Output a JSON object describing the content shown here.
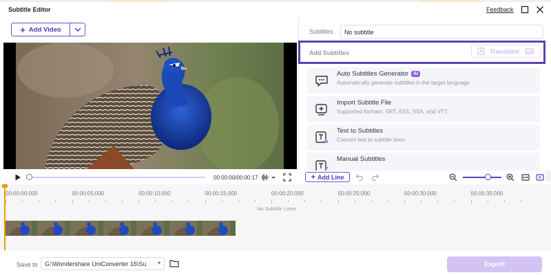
{
  "window": {
    "title": "Subtitle Editor",
    "feedback_label": "Feedback"
  },
  "toolbar": {
    "add_video_label": "Add Video"
  },
  "subtitles": {
    "label": "Subtitles",
    "selected_value": "No subtitle"
  },
  "add_subtitles": {
    "label": "Add Subtitles",
    "translator_label": "Translator",
    "translator_badge": "AI"
  },
  "options": [
    {
      "title": "Auto Subtitles Generator",
      "badge": "AI",
      "desc": "Automatically generate subtitles in the target language.",
      "icon": "speech-bubble-icon"
    },
    {
      "title": "Import Subtitle File",
      "desc": "Supported formats: SRT, ASS, SSA, and VTT.",
      "icon": "import-subtitle-icon"
    },
    {
      "title": "Text to Subtitles",
      "desc": "Convert text to subtitle lines.",
      "icon": "text-to-subtitle-icon"
    },
    {
      "title": "Manual Subtitles",
      "desc": "",
      "icon": "manual-subtitle-icon"
    }
  ],
  "player": {
    "timecode": "00:00:00/00:00:17",
    "add_line_label": "Add Line",
    "progress": 0
  },
  "timeline": {
    "ruler": [
      "00:00:00:000",
      "00:00:05:000",
      "00:00:10:000",
      "00:00:15:000",
      "00:00:20:000",
      "00:00:25:000",
      "00:00:30:000",
      "00:00:35:000"
    ],
    "empty_message": "No Subtitle Lines"
  },
  "footer": {
    "save_to_label": "Save to",
    "save_path": "G:\\Wondershare UniConverter 16\\Su",
    "export_label": "Export"
  },
  "colors": {
    "accent": "#5b3fb5",
    "export_disabled": "#d3c3f5",
    "playhead": "#e0a400"
  }
}
